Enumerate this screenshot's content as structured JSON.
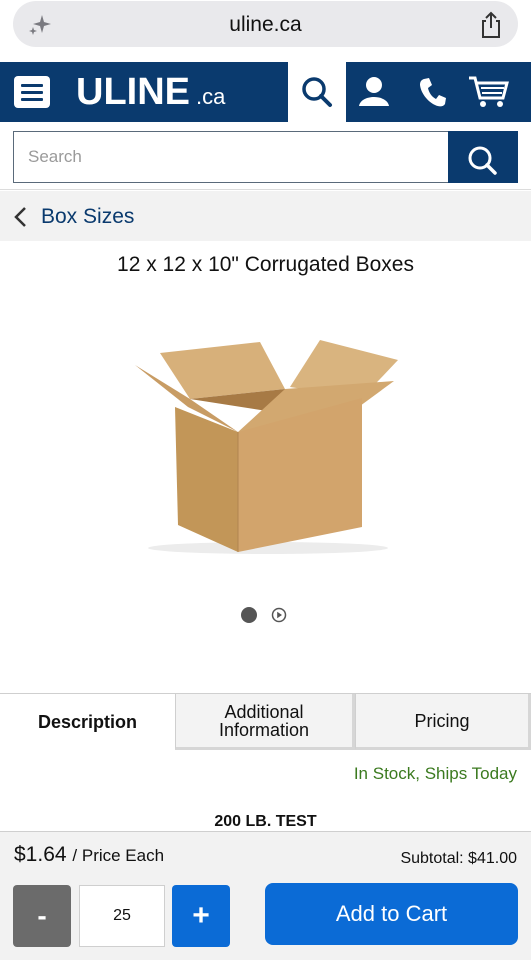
{
  "browser": {
    "url": "uline.ca",
    "sparkle_icon": "sparkle-icon",
    "share_icon": "share-icon"
  },
  "header": {
    "logo_main": "ULINE",
    "logo_tld": ".ca",
    "icons": [
      "menu-icon",
      "search-icon",
      "account-icon",
      "phone-icon",
      "cart-icon"
    ],
    "brand_color": "#0a3a6e"
  },
  "search": {
    "placeholder": "Search"
  },
  "breadcrumb": {
    "label": "Box Sizes"
  },
  "product": {
    "title": "12 x 12 x 10\" Corrugated Boxes",
    "image_slides": 2,
    "active_slide": 1
  },
  "tabs": [
    {
      "label": "Description",
      "active": true
    },
    {
      "label": "Additional Information",
      "active": false
    },
    {
      "label": "Pricing",
      "active": false
    }
  ],
  "stock_status": "In Stock, Ships Today",
  "stock_color": "#3b7a1f",
  "spec_heading": "200 LB. TEST",
  "purchase": {
    "price": "$1.64",
    "price_suffix": "/ Price Each",
    "subtotal": "Subtotal: $41.00",
    "minus_label": "-",
    "quantity": "25",
    "plus_label": "+",
    "add_to_cart_label": "Add to Cart",
    "accent_color": "#0b6bd6"
  }
}
